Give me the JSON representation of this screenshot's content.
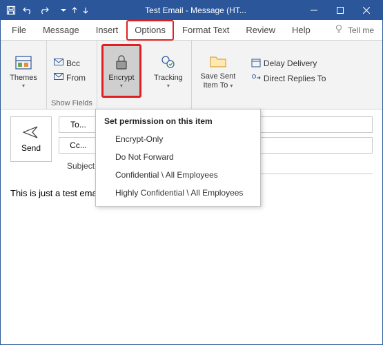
{
  "window": {
    "title": "Test Email  -  Message (HT..."
  },
  "tabs": {
    "file": "File",
    "message": "Message",
    "insert": "Insert",
    "options": "Options",
    "format": "Format Text",
    "review": "Review",
    "help": "Help",
    "tellme": "Tell me"
  },
  "ribbon": {
    "themes": "Themes",
    "bcc": "Bcc",
    "from": "From",
    "show_fields": "Show Fields",
    "encrypt": "Encrypt",
    "tracking": "Tracking",
    "save_sent": "Save Sent Item To",
    "delay": "Delay Delivery",
    "direct": "Direct Replies To"
  },
  "menu": {
    "header": "Set permission on this item",
    "opt1": "Encrypt-Only",
    "opt2": "Do Not Forward",
    "opt3": "Confidential \\ All Employees",
    "opt4": "Highly Confidential \\ All Employees"
  },
  "compose": {
    "send": "Send",
    "to": "To...",
    "cc": "Cc...",
    "subject_label": "Subject"
  },
  "body": "This is just a test email."
}
